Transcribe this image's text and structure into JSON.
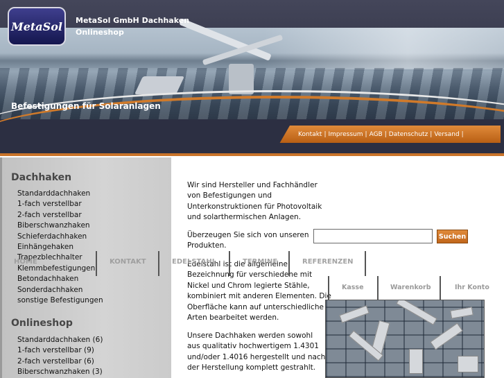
{
  "header": {
    "logo_text": "MetaSol",
    "company_line1": "MetaSol GmbH Dachhaken",
    "company_line2": "Onlineshop",
    "tagline": "Befestigungen für Solaranlagen",
    "top_links": [
      "Kontakt",
      "Impressum",
      "AGB",
      "Datenschutz",
      "Versand"
    ]
  },
  "sidebar": {
    "section1_title": "Dachhaken",
    "section1_items": [
      "Standarddachhaken",
      "1-fach verstellbar",
      "2-fach verstellbar",
      "Biberschwanzhaken",
      "Schieferdachhaken",
      "Einhängehaken",
      "Trapezblechhalter",
      "Klemmbefestigungen",
      "Betondachhaken",
      "Sonderdachhaken",
      "sonstige Befestigungen"
    ],
    "section2_title": "Onlineshop",
    "section2_items": [
      "Standarddachhaken (6)",
      "1-fach verstellbar (9)",
      "2-fach verstellbar (6)",
      "Biberschwanzhaken (3)"
    ]
  },
  "main": {
    "intro_lines": [
      "Wir sind Hersteller und Fachhändler",
      "von Befestigungen und",
      "Unterkonstruktionen für Photovoltaik",
      "und solarthermischen Anlagen."
    ],
    "convince_lines": [
      "Überzeugen Sie sich von unseren",
      "Produkten."
    ],
    "steel_lines": [
      "Edelstahl ist die allgemeine",
      "Bezeichnung für verschiedene mit",
      "Nickel und Chrom legierte Stähle,",
      "kombiniert mit anderen Elementen. Die",
      "Oberfläche kann auf unterschiedliche",
      "Arten bearbeitet werden."
    ],
    "hooks_lines": [
      "Unsere Dachhaken werden sowohl",
      "aus qualitativ hochwertigem 1.4301",
      "und/oder 1.4016 hergestellt und nach",
      "der Herstellung komplett gestrahlt."
    ],
    "search": {
      "value": "",
      "button_label": "Suchen"
    }
  },
  "overlay_nav": {
    "items": [
      "HOME",
      "KONTAKT",
      "EDELSTAHL",
      "TERMINE",
      "REFERENZEN"
    ],
    "shop_items": [
      "Kasse",
      "Warenkorb",
      "Ihr Konto"
    ]
  },
  "colors": {
    "accent_orange": "#c9742a",
    "header_dark": "#2c2f42",
    "sidebar_gray": "#cfcfcf"
  }
}
